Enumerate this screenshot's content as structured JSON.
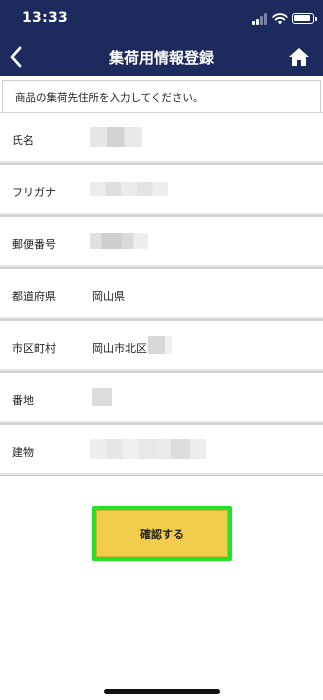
{
  "status_bar": {
    "time": "13:33"
  },
  "nav": {
    "title": "集荷用情報登録"
  },
  "notice": {
    "text": "商品の集荷先住所を入力してください。"
  },
  "form": {
    "rows": [
      {
        "label": "氏名",
        "value": ""
      },
      {
        "label": "フリガナ",
        "value": ""
      },
      {
        "label": "郵便番号",
        "value": ""
      },
      {
        "label": "都道府県",
        "value": "岡山県"
      },
      {
        "label": "市区町村",
        "value": "岡山市北区"
      },
      {
        "label": "番地",
        "value": ""
      },
      {
        "label": "建物",
        "value": ""
      }
    ]
  },
  "confirm_button": {
    "label": "確認する"
  },
  "colors": {
    "header_bg": "#1d2a5e",
    "button_fill": "#f2cd4c",
    "button_highlight": "#22e22a"
  },
  "icons": [
    "back-chevron-icon",
    "home-icon",
    "signal-icon",
    "wifi-icon",
    "battery-icon"
  ]
}
